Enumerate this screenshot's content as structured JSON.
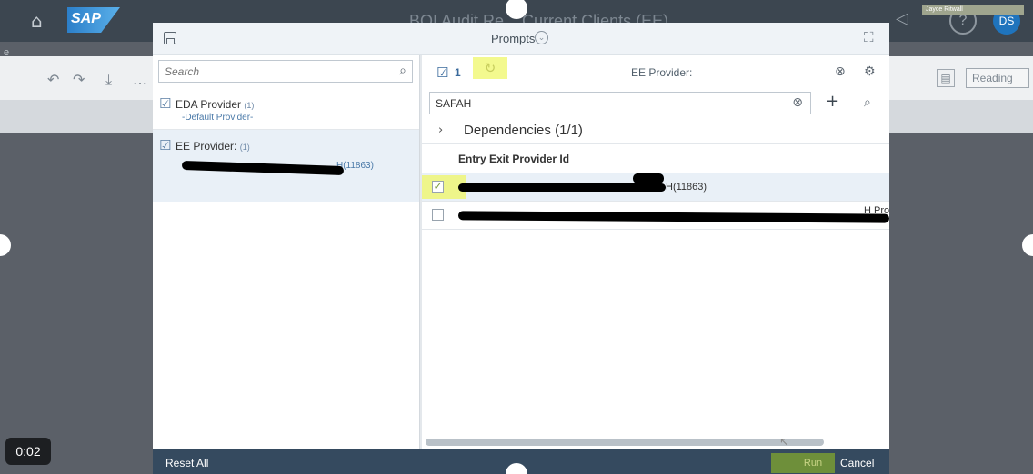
{
  "background": {
    "title": "BOI Audit Re... Current Clients (EE)",
    "reading_label": "Reading",
    "user_initials": "DS",
    "user_tag": "Jayce Ritwall",
    "edge_text": "e"
  },
  "timer": "0:02",
  "dialog": {
    "title": "Prompts",
    "left": {
      "search_placeholder": "Search",
      "items": [
        {
          "name": "EDA Provider",
          "count": "(1)",
          "sub": "-Default Provider-"
        },
        {
          "name": "EE Provider:",
          "count": "(1)",
          "sub": "H(11863)"
        }
      ]
    },
    "right": {
      "selected_count": "1",
      "label": "EE Provider:",
      "search_value": "SAFAH",
      "dependencies": "Dependencies (1/1)",
      "column_header": "Entry Exit Provider Id",
      "rows": [
        {
          "text": "H(11863)",
          "checked": true
        },
        {
          "text": "H Prog",
          "checked": false
        }
      ]
    },
    "footer": {
      "reset": "Reset All",
      "run": "Run",
      "cancel": "Cancel"
    }
  },
  "colors": {
    "footer_bg": "#354a5f",
    "run_bg": "#6e8f3a",
    "highlight": "#eef58a",
    "selected_row": "#e9f0f7"
  }
}
